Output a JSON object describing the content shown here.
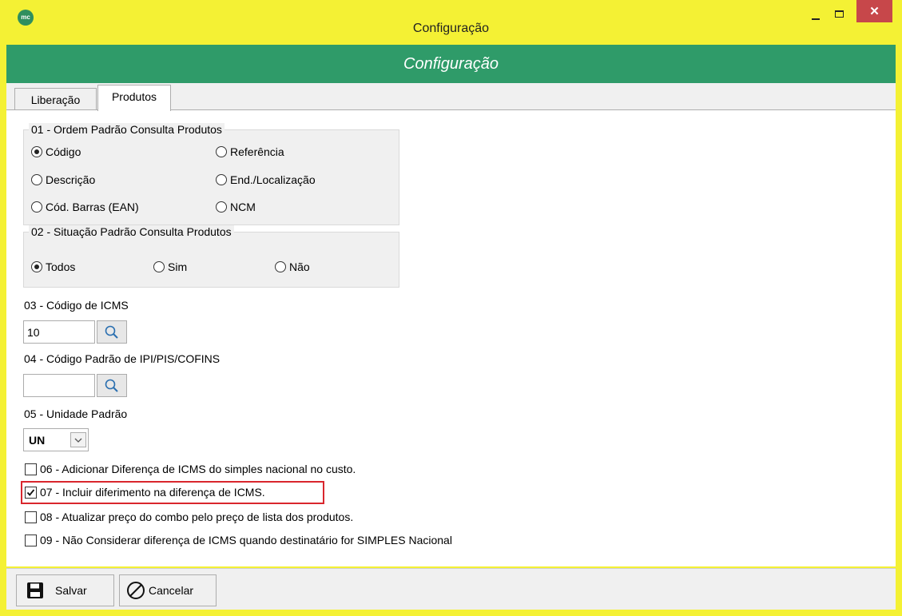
{
  "window": {
    "title": "Configuração",
    "logo_text": "mc",
    "close_glyph": "✕"
  },
  "banner": {
    "title": "Configuração"
  },
  "tabs": [
    {
      "label": "Liberação",
      "active": false
    },
    {
      "label": "Produtos",
      "active": true
    }
  ],
  "group1": {
    "legend": "01 - Ordem Padrão Consulta Produtos",
    "options": [
      {
        "label": "Código",
        "selected": true
      },
      {
        "label": "Referência",
        "selected": false
      },
      {
        "label": "Descrição",
        "selected": false
      },
      {
        "label": "End./Localização",
        "selected": false
      },
      {
        "label": "Cód. Barras (EAN)",
        "selected": false
      },
      {
        "label": "NCM",
        "selected": false
      }
    ]
  },
  "group2": {
    "legend": "02 - Situação Padrão Consulta Produtos",
    "options": [
      {
        "label": "Todos",
        "selected": true
      },
      {
        "label": "Sim",
        "selected": false
      },
      {
        "label": "Não",
        "selected": false
      }
    ]
  },
  "icms": {
    "label": "03 - Código de ICMS",
    "value": "10"
  },
  "ipi": {
    "label": "04 - Código Padrão de IPI/PIS/COFINS",
    "value": ""
  },
  "unidade": {
    "label": "05 - Unidade Padrão",
    "value": "UN"
  },
  "checks": [
    {
      "label": "06 - Adicionar Diferença de ICMS do simples nacional no custo.",
      "checked": false
    },
    {
      "label": "07 - Incluir diferimento na diferença de ICMS.",
      "checked": true
    },
    {
      "label": "08 - Atualizar preço do combo pelo preço de lista dos produtos.",
      "checked": false
    },
    {
      "label": "09 - Não Considerar diferença de ICMS quando destinatário for SIMPLES Nacional",
      "checked": false
    }
  ],
  "footer": {
    "save_label": "Salvar",
    "cancel_label": "Cancelar"
  },
  "colors": {
    "banner": "#2f9b69",
    "titlebar": "#f4f134",
    "highlight": "#d9262d",
    "close": "#c7474a"
  }
}
